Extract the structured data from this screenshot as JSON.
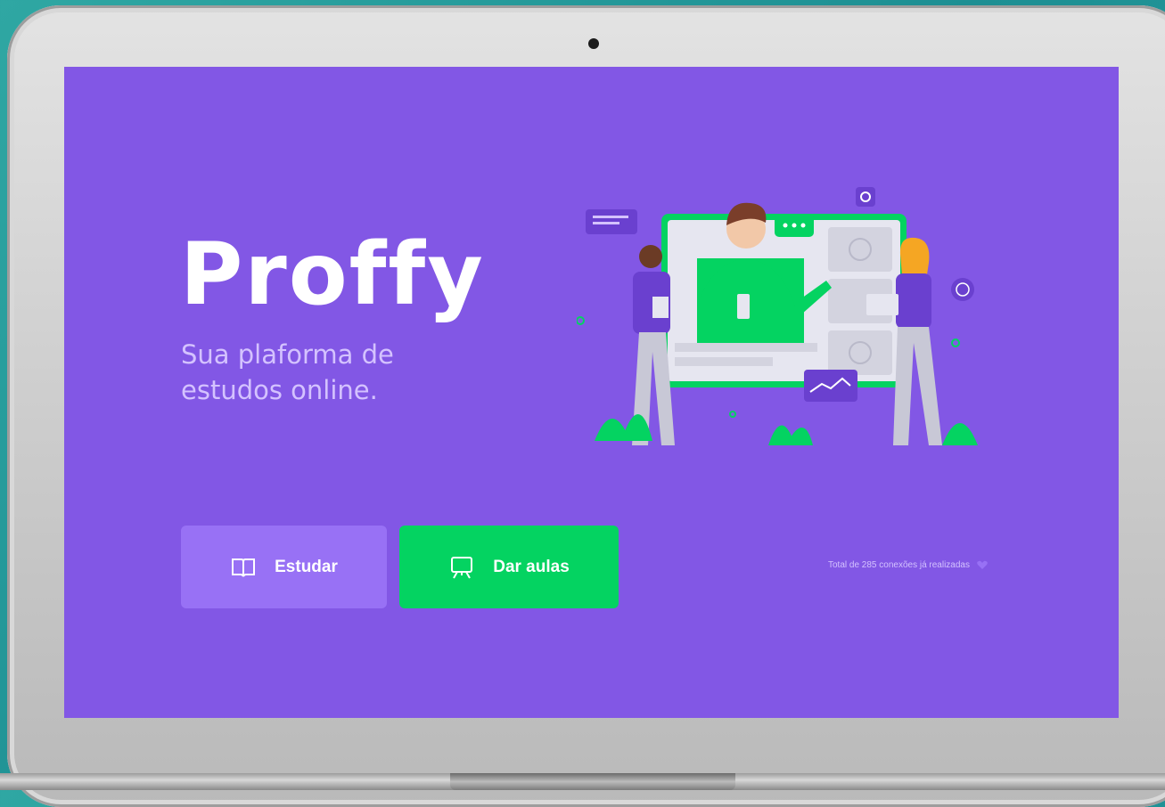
{
  "app": {
    "logo_text": "Proffy",
    "tagline_line1": "Sua plaforma de",
    "tagline_line2": "estudos online."
  },
  "actions": {
    "study_label": "Estudar",
    "teach_label": "Dar aulas"
  },
  "footer": {
    "total_connections_text": "Total de 285 conexões já realizadas"
  },
  "icons": {
    "study": "book-open-icon",
    "teach": "presentation-board-icon",
    "heart": "heart-icon"
  },
  "colors": {
    "background": "#8257e5",
    "study_button": "#9871f5",
    "teach_button": "#04d361",
    "tagline": "#d4c2ff"
  }
}
